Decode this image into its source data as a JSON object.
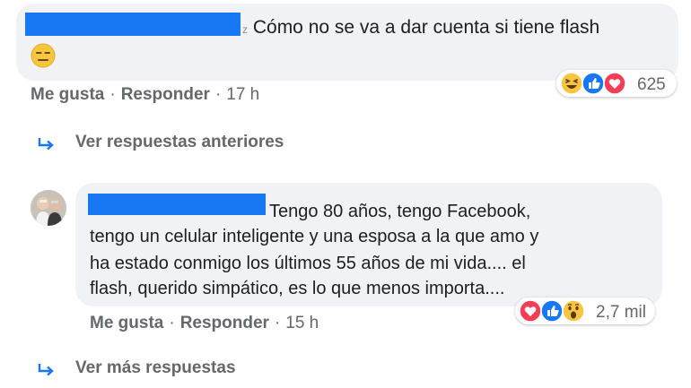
{
  "comment1": {
    "author_visible_fragment": "z",
    "text": "Cómo no se va a dar cuenta si tiene flash",
    "reaction_count": "625",
    "reactions": [
      "haha-icon",
      "like-icon",
      "love-icon"
    ],
    "actions": {
      "like": "Me gusta",
      "reply": "Responder",
      "time": "17 h"
    }
  },
  "view_previous_replies": "Ver respuestas anteriores",
  "comment2": {
    "lines": [
      "Tengo 80 años, tengo Facebook,",
      "tengo un celular inteligente y una esposa a la que amo y",
      "ha estado conmigo los últimos 55 años de mi vida.... el",
      "flash, querido simpático, es lo que menos importa...."
    ],
    "reaction_count": "2,7 mil",
    "reactions": [
      "love-icon",
      "like-icon",
      "wow-icon"
    ],
    "actions": {
      "like": "Me gusta",
      "reply": "Responder",
      "time": "15 h"
    }
  },
  "view_more_replies": "Ver más respuestas",
  "colors": {
    "bubble": "#f0f2f5",
    "redaction": "#1877f2",
    "meta_text": "#65676b",
    "like_blue": "#1877f2",
    "love_red": "#f33e58",
    "emoji_yellow": "#f7c542"
  }
}
